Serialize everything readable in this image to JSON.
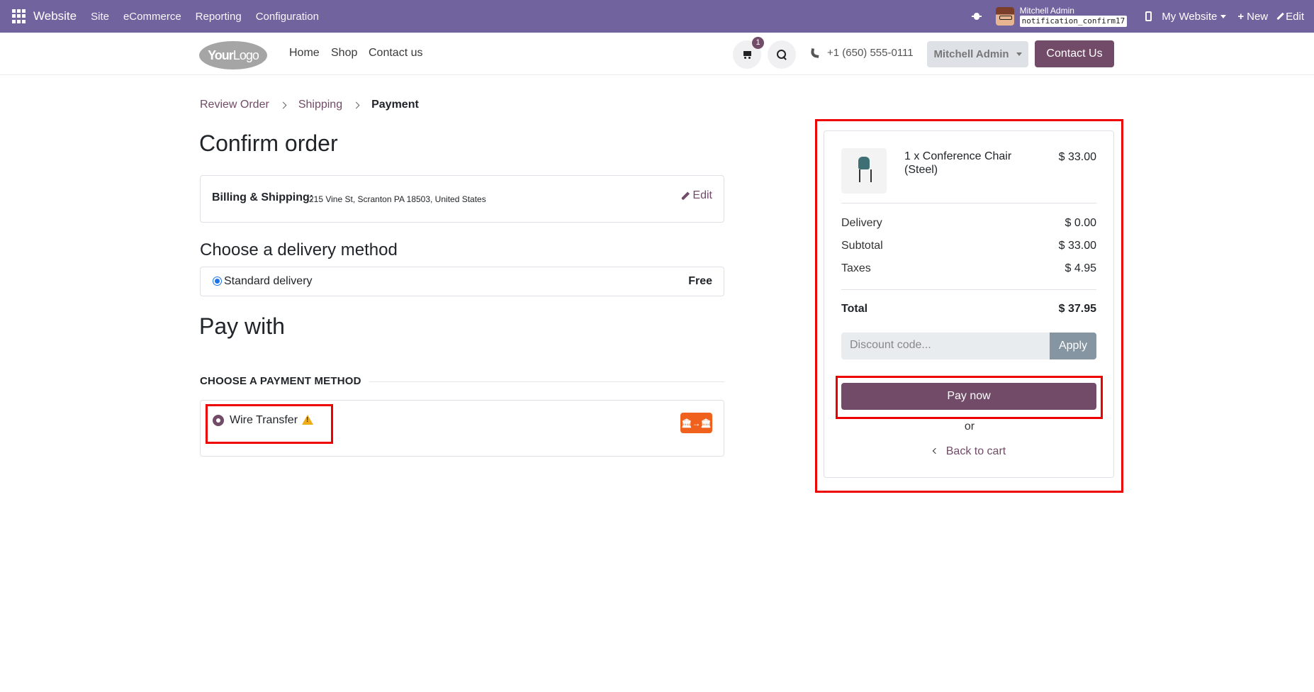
{
  "topbar": {
    "brand": "Website",
    "menu": [
      "Site",
      "eCommerce",
      "Reporting",
      "Configuration"
    ],
    "user_name": "Mitchell Admin",
    "db_name": "notification_confirm17",
    "my_website": "My Website",
    "new_label": "New",
    "edit_label": "Edit",
    "bg_color": "#71639e"
  },
  "header": {
    "logo_bold": "Your",
    "logo_light": "Logo",
    "nav": [
      "Home",
      "Shop",
      "Contact us"
    ],
    "cart_count": "1",
    "phone": "+1 (650) 555-0111",
    "user_button": "Mitchell Admin",
    "contact_button": "Contact Us"
  },
  "breadcrumb": {
    "items": [
      "Review Order",
      "Shipping"
    ],
    "current": "Payment"
  },
  "page": {
    "title": "Confirm order",
    "billing_label": "Billing & Shipping:",
    "billing_address": "215 Vine St, Scranton PA 18503, United States",
    "edit_label": "Edit",
    "delivery_heading": "Choose a delivery method",
    "delivery_name": "Standard delivery",
    "delivery_price": "Free",
    "pay_heading": "Pay with",
    "payment_method_heading": "CHOOSE A PAYMENT METHOD",
    "payment_name": "Wire Transfer",
    "payment_icon_text": "🏛→🏛"
  },
  "summary": {
    "item_name": "1 x Conference Chair (Steel)",
    "item_price": "$ 33.00",
    "delivery_label": "Delivery",
    "delivery_value": "$ 0.00",
    "subtotal_label": "Subtotal",
    "subtotal_value": "$ 33.00",
    "taxes_label": "Taxes",
    "taxes_value": "$ 4.95",
    "total_label": "Total",
    "total_value": "$ 37.95",
    "discount_placeholder": "Discount code...",
    "apply_label": "Apply",
    "pay_label": "Pay now",
    "or_label": "or",
    "back_label": "Back to cart"
  },
  "colors": {
    "primary": "#714b67",
    "highlight": "#ee0000"
  }
}
